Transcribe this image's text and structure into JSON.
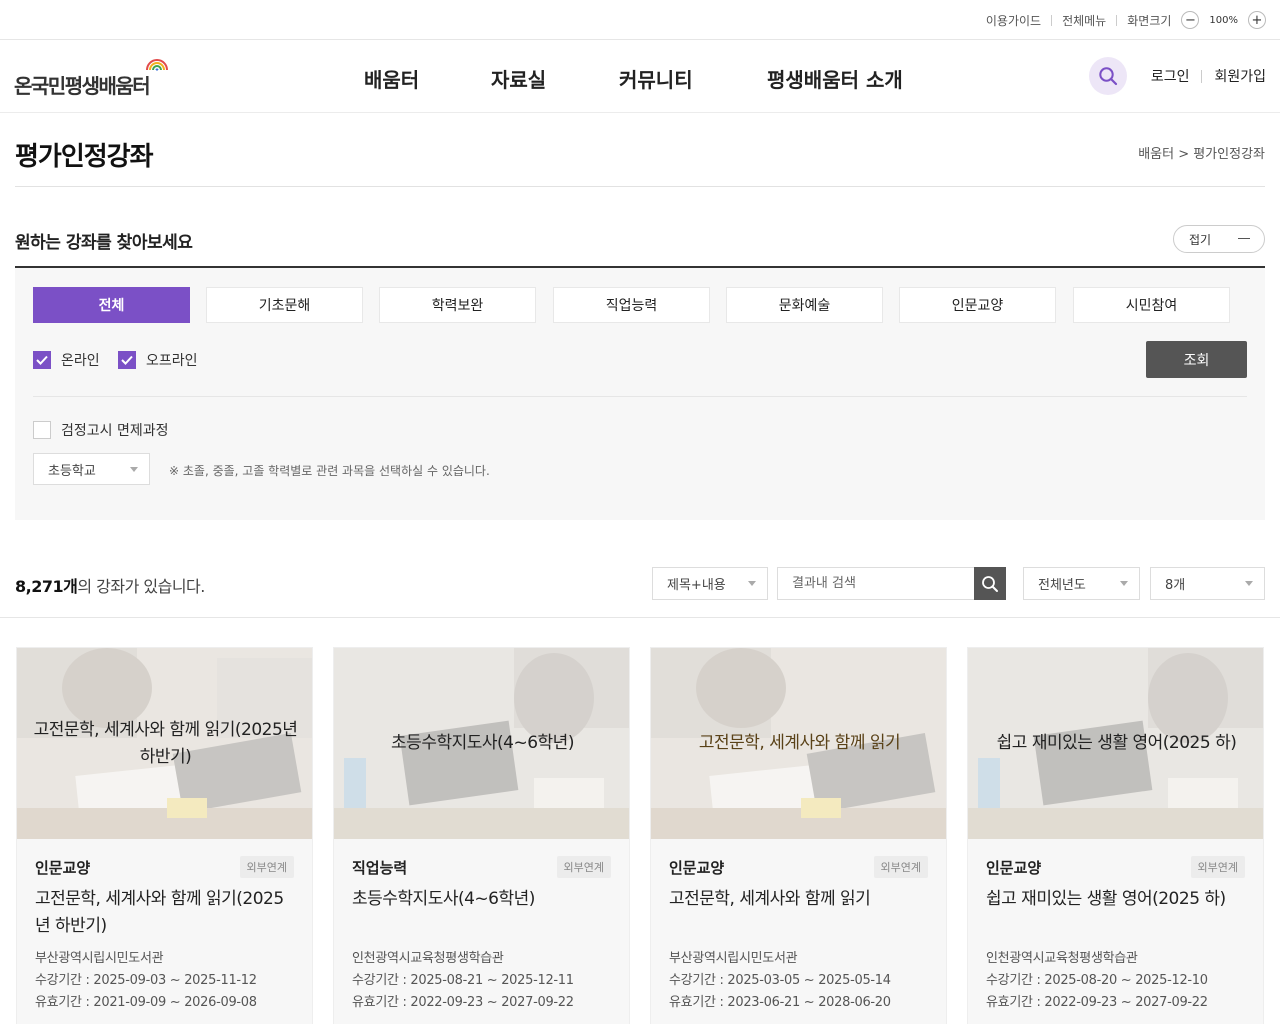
{
  "utility": {
    "guide": "이용가이드",
    "all_menu": "전체메뉴",
    "screen_size": "화면크기",
    "zoom_out": "−",
    "zoom": "100%",
    "zoom_in": "+"
  },
  "header": {
    "logo_text": "온국민평생배움터",
    "nav": [
      "배움터",
      "자료실",
      "커뮤니티",
      "평생배움터 소개"
    ],
    "login": "로그인",
    "signup": "회원가입"
  },
  "page": {
    "title": "평가인정강좌",
    "breadcrumb": "배움터 > 평가인정강좌"
  },
  "filter": {
    "title": "원하는 강좌를 찾아보세요",
    "collapse": "접기",
    "categories": [
      "전체",
      "기초문해",
      "학력보완",
      "직업능력",
      "문화예술",
      "인문교양",
      "시민참여"
    ],
    "active_category": "전체",
    "online": "온라인",
    "offline": "오프라인",
    "search_button": "조회",
    "exam_exempt": "검정고시 면제과정",
    "school_level": "초등학교",
    "hint": "※ 초졸, 중졸, 고졸 학력별로 관련 과목을 선택하실 수 있습니다."
  },
  "results": {
    "count": "8,271개",
    "count_suffix": "의 강좌가 있습니다.",
    "search_scope": "제목+내용",
    "search_placeholder": "결과내 검색",
    "year": "전체년도",
    "per_page": "8개"
  },
  "cards": [
    {
      "thumb_title": "고전문학, 세계사와 함께 읽기(2025년 하반기)",
      "category": "인문교양",
      "badge": "외부연계",
      "title": "고전문학, 세계사와 함께 읽기(2025년 하반기)",
      "org": "부산광역시립시민도서관",
      "period": "수강기간 : 2025-09-03 ~ 2025-11-12",
      "valid": "유효기간 : 2021-09-09 ~ 2026-09-08"
    },
    {
      "thumb_title": "초등수학지도사(4~6학년)",
      "category": "직업능력",
      "badge": "외부연계",
      "title": "초등수학지도사(4~6학년)",
      "org": "인천광역시교육청평생학습관",
      "period": "수강기간 : 2025-08-21 ~ 2025-12-11",
      "valid": "유효기간 : 2022-09-23 ~ 2027-09-22"
    },
    {
      "thumb_title": "고전문학, 세계사와 함께 읽기",
      "category": "인문교양",
      "badge": "외부연계",
      "title": "고전문학, 세계사와 함께 읽기",
      "org": "부산광역시립시민도서관",
      "period": "수강기간 : 2025-03-05 ~ 2025-05-14",
      "valid": "유효기간 : 2023-06-21 ~ 2028-06-20"
    },
    {
      "thumb_title": "쉽고 재미있는 생활 영어(2025 하)",
      "category": "인문교양",
      "badge": "외부연계",
      "title": "쉽고 재미있는 생활 영어(2025 하)",
      "org": "인천광역시교육청평생학습관",
      "period": "수강기간 : 2025-08-20 ~ 2025-12-10",
      "valid": "유효기간 : 2022-09-23 ~ 2027-09-22"
    }
  ],
  "colors": {
    "accent": "#7b50c6",
    "dark_button": "#555555",
    "filter_bg": "#f7f7f7"
  },
  "icons": {
    "search": "search-icon",
    "check": "check-icon",
    "dropdown": "caret-down-icon",
    "rainbow": "rainbow-logo-icon"
  }
}
